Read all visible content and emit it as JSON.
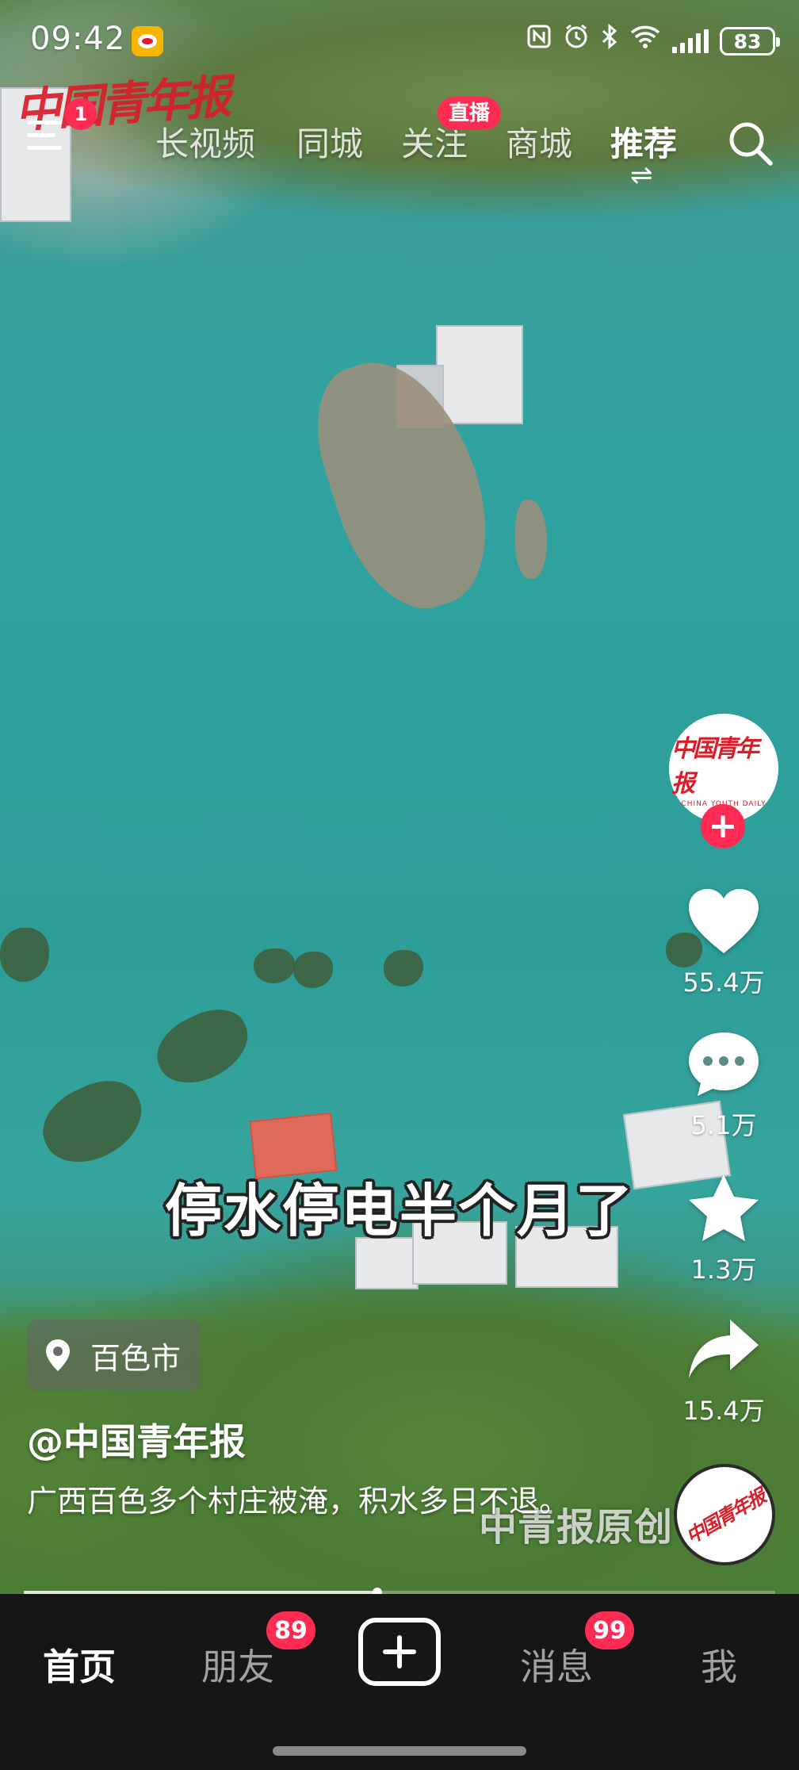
{
  "status_bar": {
    "time": "09:42",
    "notification_icon": "weibo-icon",
    "icons": [
      "nfc-icon",
      "alarm-icon",
      "bluetooth-icon",
      "wifi-icon",
      "signal-icon"
    ],
    "battery": "83"
  },
  "watermark": {
    "logo_text": "中国青年报"
  },
  "top_nav": {
    "menu_badge": "1",
    "tabs": [
      {
        "label": "长视频",
        "active": false
      },
      {
        "label": "同城",
        "active": false
      },
      {
        "label": "关注",
        "active": false,
        "badge": "直播"
      },
      {
        "label": "商城",
        "active": false
      },
      {
        "label": "推荐",
        "active": true
      }
    ],
    "swap_glyph": "⇌",
    "search_icon": "search-icon"
  },
  "author": {
    "avatar_text": "中国青年报",
    "avatar_subtext": "CHINA YOUTH DAILY",
    "follow_icon": "plus-icon",
    "handle": "@中国青年报"
  },
  "actions": {
    "like": {
      "icon": "heart-icon",
      "count": "55.4万"
    },
    "comment": {
      "icon": "comment-icon",
      "count": "5.1万"
    },
    "favorite": {
      "icon": "star-icon",
      "count": "1.3万"
    },
    "share": {
      "icon": "share-icon",
      "count": "15.4万"
    }
  },
  "music_disc": {
    "text": "中国青年报"
  },
  "video": {
    "subtitle": "停水停电半个月了",
    "overlay_watermark": "中青报原创"
  },
  "location": {
    "icon": "location-pin-icon",
    "label": "百色市"
  },
  "description": "广西百色多个村庄被淹，积水多日不退。",
  "playback": {
    "progress": 0.47
  },
  "bottom_nav": {
    "tabs": [
      {
        "label": "首页",
        "active": true
      },
      {
        "label": "朋友",
        "badge": "89"
      },
      {
        "label": "create",
        "icon": "plus-icon"
      },
      {
        "label": "消息",
        "badge": "99"
      },
      {
        "label": "我"
      }
    ]
  },
  "colors": {
    "accent": "#fe2c55",
    "brand_red": "#d81e2a",
    "tabbar_bg": "#161616",
    "water": "#2fa3a0"
  }
}
